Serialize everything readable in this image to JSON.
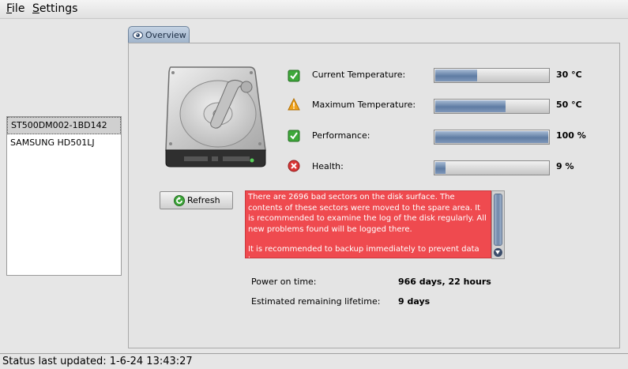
{
  "menu": {
    "file": {
      "mnemonic": "F",
      "rest": "ile"
    },
    "settings": {
      "mnemonic": "S",
      "rest": "ettings"
    }
  },
  "drives": [
    {
      "name": "ST500DM002-1BD142",
      "selected": true
    },
    {
      "name": "SAMSUNG HD501LJ",
      "selected": false
    }
  ],
  "tab": {
    "label": "Overview",
    "icon": "disk-eye-icon"
  },
  "metrics": [
    {
      "label": "Current Temperature:",
      "value": "30 °C",
      "level": 0.37,
      "status_icon": "check-icon"
    },
    {
      "label": "Maximum Temperature:",
      "value": "50 °C",
      "level": 0.62,
      "status_icon": "warning-icon"
    },
    {
      "label": "Performance:",
      "value": "100 %",
      "level": 1.0,
      "status_icon": "check-icon"
    },
    {
      "label": "Health:",
      "value": "9 %",
      "level": 0.09,
      "status_icon": "error-icon"
    }
  ],
  "refresh": {
    "label": "Refresh"
  },
  "message": {
    "paragraph1": "There are 2696 bad sectors on the disk surface. The contents of these sectors were moved to the spare area. It is recommended to examine the log of the disk regularly. All new problems found will be logged there.",
    "paragraph2": "It is recommended to backup immediately to prevent data loss."
  },
  "info": {
    "power_on_label": "Power on time:",
    "power_on_value": "966 days, 22 hours",
    "lifetime_label": "Estimated remaining lifetime:",
    "lifetime_value": "9 days"
  },
  "status": {
    "text": "Status last updated: 1-6-24 13:43:27"
  },
  "colors": {
    "message_bg": "#ef4a4f",
    "bar_fill": "#5f7ca3",
    "ok": "#2e9d2a",
    "warning": "#f0a21a",
    "error": "#d93636"
  }
}
